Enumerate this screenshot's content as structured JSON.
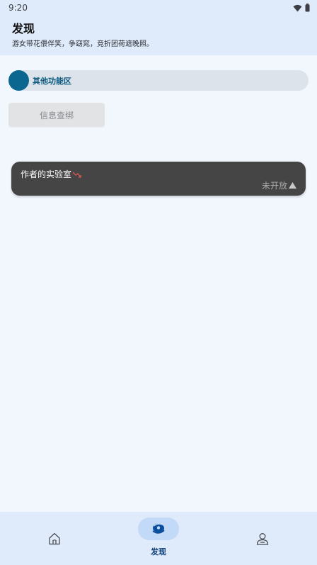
{
  "status_bar": {
    "time": "9:20",
    "icons": [
      "wifi-icon",
      "battery-icon"
    ]
  },
  "header": {
    "title": "发现",
    "subtitle": "游女带花偎伴笑，争窈窕，竞折团荷遮晚照。"
  },
  "section": {
    "label": "其他功能区",
    "accent_color": "#0b6690"
  },
  "info_button": {
    "label": "信息查绑"
  },
  "lab_card": {
    "title": "作者的实验室",
    "title_icon": "trend-down-icon",
    "status": "未开放",
    "status_icon": "triangle-up-icon",
    "background": "#454545"
  },
  "bottom_nav": {
    "items": [
      {
        "icon": "home-icon",
        "label": "",
        "active": false
      },
      {
        "icon": "discover-icon",
        "label": "发现",
        "active": true
      },
      {
        "icon": "profile-icon",
        "label": "",
        "active": false
      }
    ]
  }
}
